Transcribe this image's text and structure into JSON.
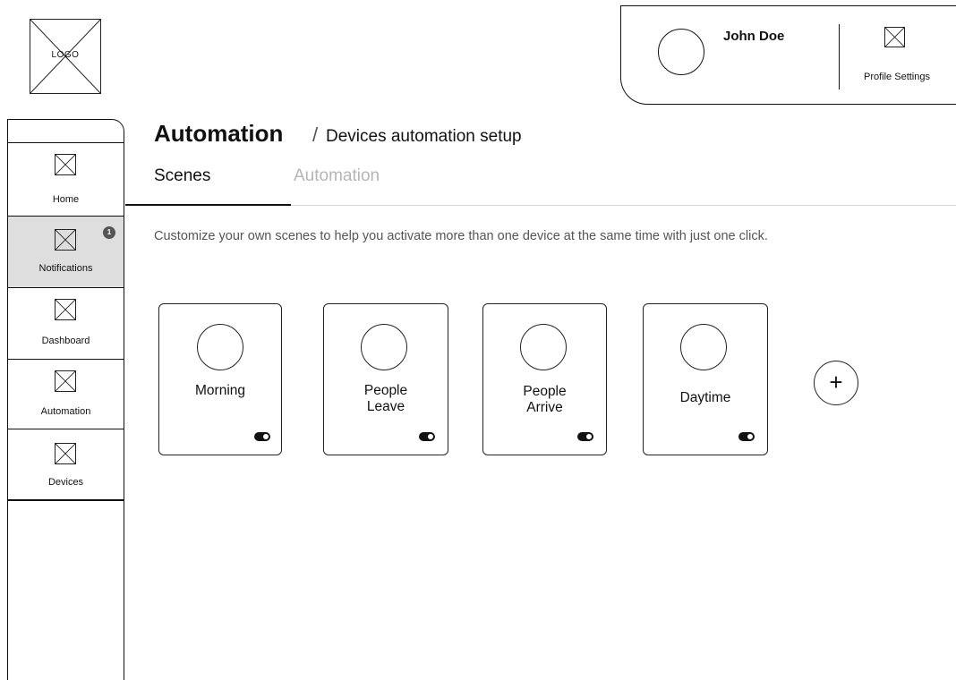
{
  "logo": {
    "text": "LOGO"
  },
  "profile": {
    "name": "John Doe",
    "settings_label": "Profile Settings"
  },
  "sidebar": {
    "items": [
      {
        "label": "Home",
        "icon": "placeholder-icon"
      },
      {
        "label": "Notifications",
        "icon": "placeholder-icon",
        "badge": "1",
        "active": true
      },
      {
        "label": "Dashboard",
        "icon": "placeholder-icon"
      },
      {
        "label": "Automation",
        "icon": "placeholder-icon"
      },
      {
        "label": "Devices",
        "icon": "placeholder-icon"
      }
    ]
  },
  "header": {
    "title": "Automation",
    "separator": "/",
    "subtitle": "Devices automation setup"
  },
  "tabs": [
    {
      "label": "Scenes",
      "active": true
    },
    {
      "label": "Automation",
      "active": false
    }
  ],
  "description": "Customize your own scenes to help you activate more than one device at the same time with just one click.",
  "scenes": [
    {
      "label_line1": "Morning",
      "label_line2": "",
      "enabled": true
    },
    {
      "label_line1": "People",
      "label_line2": "Leave",
      "enabled": true
    },
    {
      "label_line1": "People",
      "label_line2": "Arrive",
      "enabled": true
    },
    {
      "label_line1": "Daytime",
      "label_line2": "",
      "enabled": true
    }
  ],
  "add_scene": {
    "symbol": "+"
  },
  "colors": {
    "text": "#111111",
    "muted_text": "#555555",
    "inactive_tab": "#b5b5b5",
    "active_nav_bg": "#dedede",
    "badge_bg": "#555555"
  }
}
